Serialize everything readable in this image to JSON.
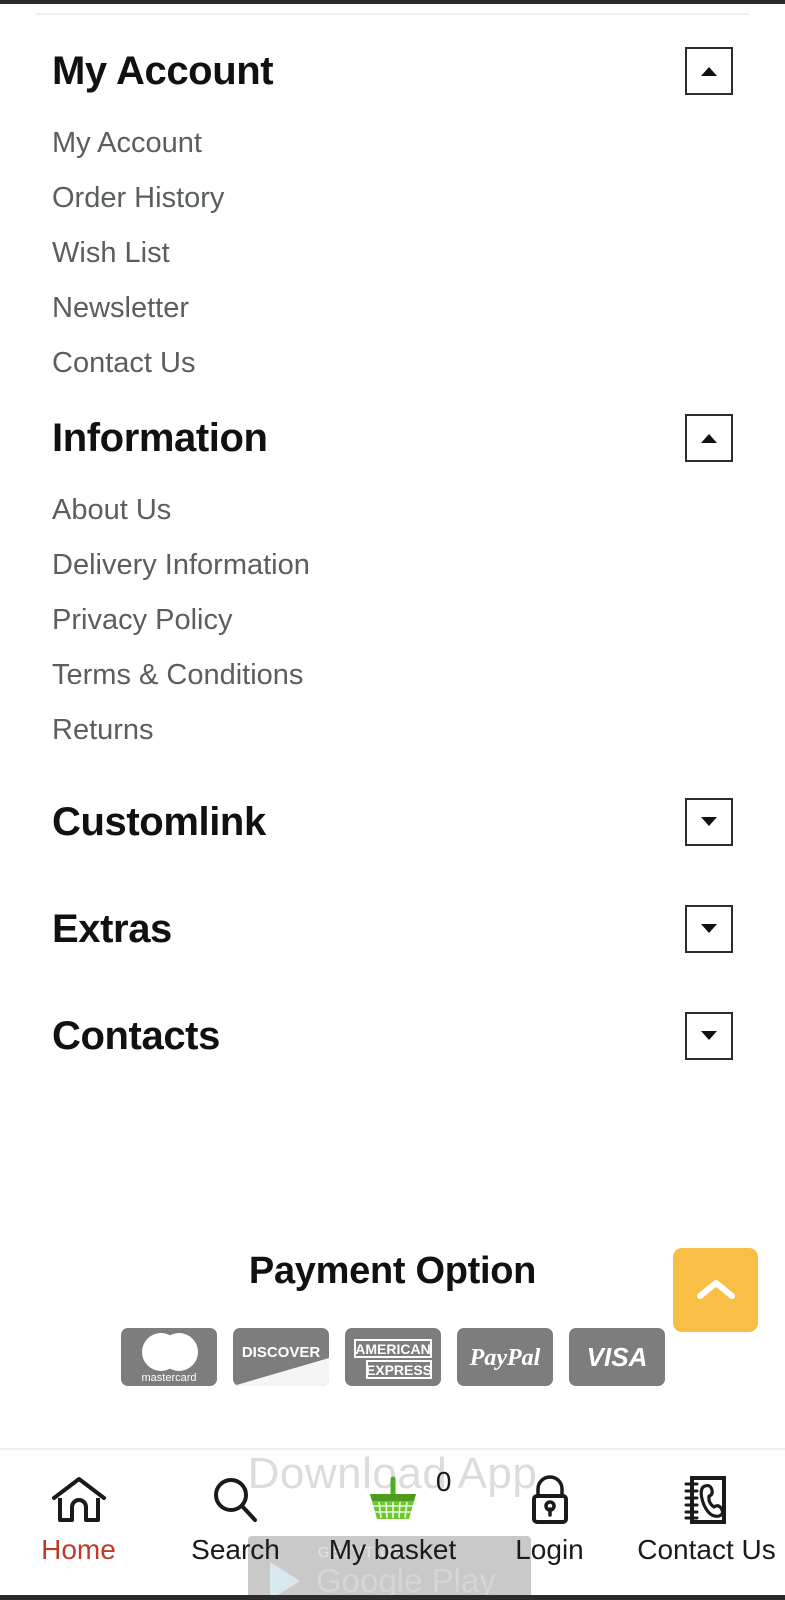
{
  "footer": {
    "sections": [
      {
        "title": "My Account",
        "expanded": true,
        "toggle_icon": "caret-up-icon",
        "links": [
          "My Account",
          "Order History",
          "Wish List",
          "Newsletter",
          "Contact Us"
        ]
      },
      {
        "title": "Information",
        "expanded": true,
        "toggle_icon": "caret-up-icon",
        "links": [
          "About Us",
          "Delivery Information",
          "Privacy Policy",
          "Terms & Conditions",
          "Returns"
        ]
      },
      {
        "title": "Customlink",
        "expanded": false,
        "toggle_icon": "caret-down-icon",
        "links": []
      },
      {
        "title": "Extras",
        "expanded": false,
        "toggle_icon": "caret-down-icon",
        "links": []
      },
      {
        "title": "Contacts",
        "expanded": false,
        "toggle_icon": "caret-down-icon",
        "links": []
      }
    ]
  },
  "payment": {
    "title": "Payment Option",
    "cards": [
      {
        "name": "mastercard",
        "label": "mastercard"
      },
      {
        "name": "discover",
        "label": "DISCOVER"
      },
      {
        "name": "american-express",
        "label": "AMERICAN EXPRESS"
      },
      {
        "name": "paypal",
        "label": "PayPal"
      },
      {
        "name": "visa",
        "label": "VISA"
      }
    ]
  },
  "scroll_top": {
    "icon": "chevron-up-icon",
    "color": "#f9be46"
  },
  "download_app": {
    "watermark": "Download App",
    "play_badge": {
      "pretext": "GET IT ON",
      "store": "Google Play"
    }
  },
  "bottom_nav": {
    "active_color": "#c0392b",
    "items": [
      {
        "label": "Home",
        "icon": "home-icon",
        "active": true
      },
      {
        "label": "Search",
        "icon": "search-icon",
        "active": false
      },
      {
        "label": "My basket",
        "icon": "basket-icon",
        "active": false,
        "count": "0"
      },
      {
        "label": "Login",
        "icon": "lock-icon",
        "active": false
      },
      {
        "label": "Contact Us",
        "icon": "phonebook-icon",
        "active": false
      }
    ]
  }
}
